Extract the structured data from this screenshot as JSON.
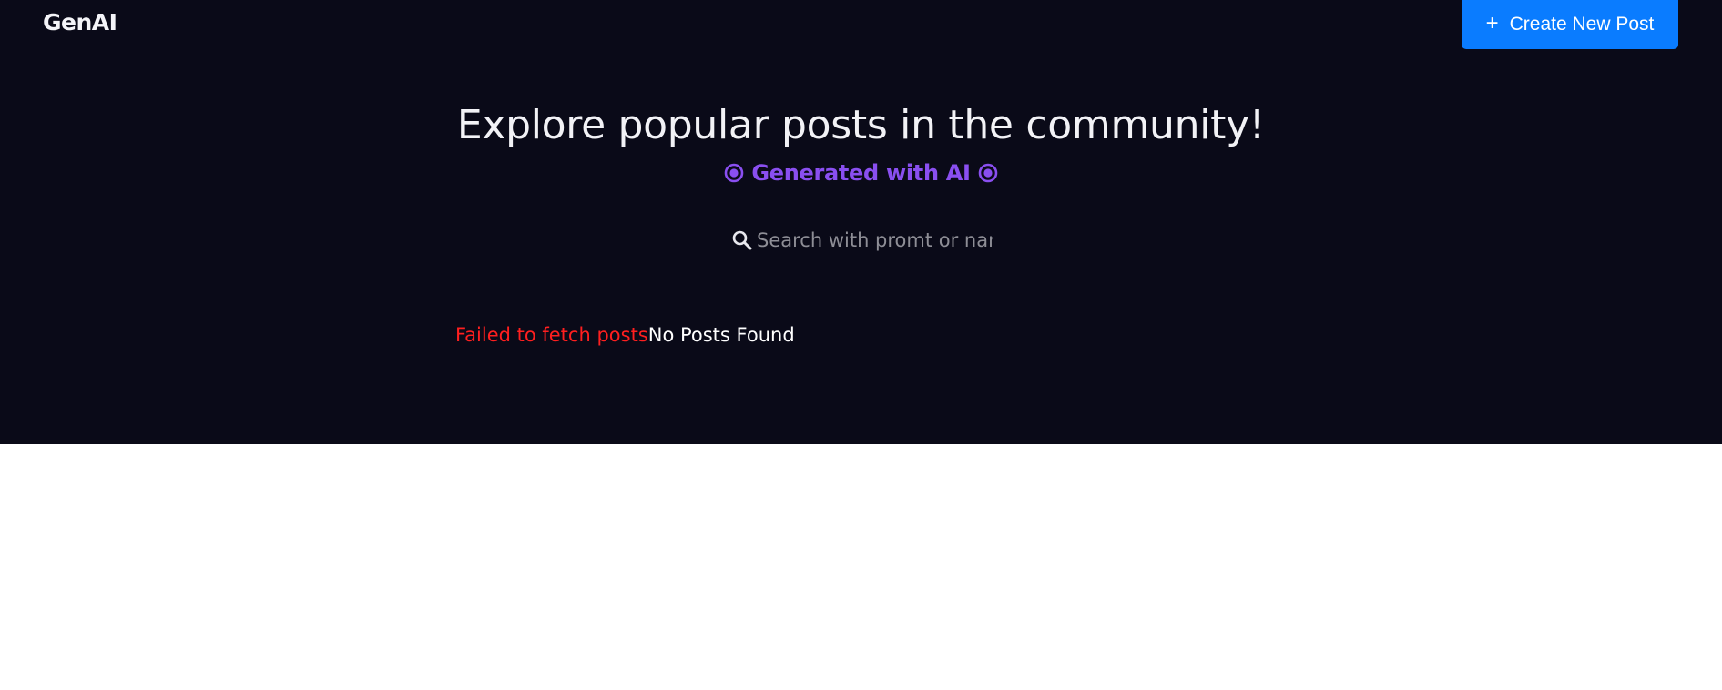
{
  "header": {
    "logo": "GenAI",
    "create_button": {
      "icon": "plus-icon",
      "label": "Create New Post"
    }
  },
  "hero": {
    "title": "Explore popular posts in the community!",
    "subtitle": "Generated with AI",
    "subtitle_icon": "target-icon"
  },
  "search": {
    "icon": "search-icon",
    "placeholder": "Search with promt or nan"
  },
  "status": {
    "error": "Failed to fetch posts",
    "empty": "No Posts Found"
  },
  "colors": {
    "background_dark": "#0a0a18",
    "accent_blue": "#0a7cff",
    "accent_purple": "#8a4ff0",
    "error_red": "#ff1f1f"
  }
}
